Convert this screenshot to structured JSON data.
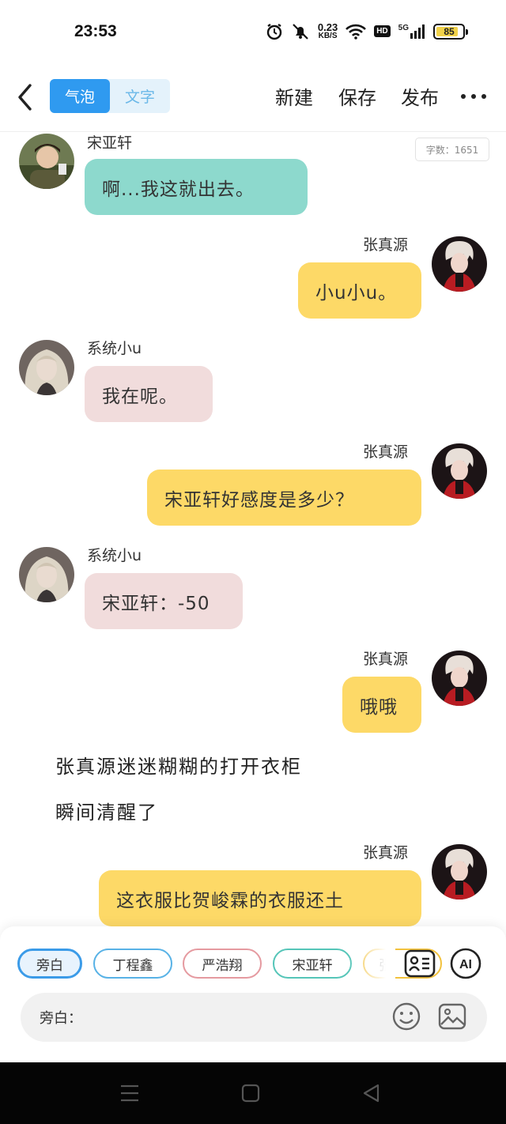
{
  "status_bar": {
    "time": "23:53",
    "net_speed_value": "0.23",
    "net_speed_unit": "KB/S",
    "hd": "HD",
    "network": "5G",
    "battery": "85",
    "battery_level_percent": 85,
    "icons": [
      "alarm-icon",
      "mute-icon",
      "wifi-icon",
      "hd-icon",
      "signal-icon",
      "battery-icon"
    ]
  },
  "toolbar": {
    "mode_options": [
      "气泡",
      "文字"
    ],
    "active_mode": "气泡",
    "new_label": "新建",
    "save_label": "保存",
    "publish_label": "发布",
    "accent_color": "#2f9af0"
  },
  "char_count": "字数：1651",
  "messages": [
    {
      "speaker": "宋亚轩",
      "side": "left",
      "text": "啊...我这就出去。",
      "bubble_color": "#8dd9cd"
    },
    {
      "speaker": "张真源",
      "side": "right",
      "text": "小u小u。",
      "bubble_color": "#fdd967"
    },
    {
      "speaker": "系统小u",
      "side": "left",
      "text": "我在呢。",
      "bubble_color": "#f1dcdc"
    },
    {
      "speaker": "张真源",
      "side": "right",
      "text": "宋亚轩好感度是多少？",
      "bubble_color": "#fdd967"
    },
    {
      "speaker": "系统小u",
      "side": "left",
      "text": "宋亚轩：-50",
      "bubble_color": "#f1dcdc"
    },
    {
      "speaker": "张真源",
      "side": "right",
      "text": "哦哦",
      "bubble_color": "#fdd967"
    }
  ],
  "narration": [
    "张真源迷迷糊糊的打开衣柜",
    "瞬间清醒了"
  ],
  "last_message": {
    "speaker": "张真源",
    "side": "right",
    "text": "这衣服比贺峻霖的衣服还土",
    "bubble_color": "#fdd967"
  },
  "character_chips": [
    {
      "label": "旁白",
      "color": "#3b9be8",
      "active": true
    },
    {
      "label": "丁程鑫",
      "color": "#58b2e6",
      "active": false
    },
    {
      "label": "严浩翔",
      "color": "#e59aa0",
      "active": false
    },
    {
      "label": "宋亚轩",
      "color": "#55c5b8",
      "active": false
    },
    {
      "label": "张",
      "color": "#f2c23e",
      "active": false
    }
  ],
  "input": {
    "label": "旁白："
  }
}
